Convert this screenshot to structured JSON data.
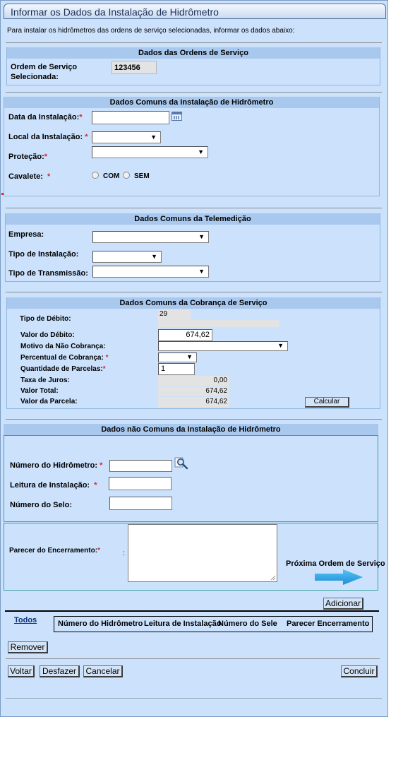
{
  "window": {
    "title": "Informar os Dados da Instalação de Hidrômetro"
  },
  "intro": "Para instalar os hidrômetros das ordens de serviço selecionadas, informar os dados abaixo:",
  "ordens": {
    "header": "Dados das Ordens de Serviço",
    "label_line1": "Ordem de Serviço",
    "label_line2": "Selecionada:",
    "value": "123456"
  },
  "instalacao": {
    "header": "Dados Comuns da Instalação de Hidrômetro",
    "data_label": "Data da Instalação:",
    "data_value": "",
    "local_label": "Local da Instalação:",
    "local_value": "",
    "protecao_label": "Proteção:",
    "protecao_value": "",
    "cavalete_label": "Cavalete:",
    "opt_com": "COM",
    "opt_sem": "SEM",
    "required_mark": "*"
  },
  "telemedicao": {
    "header": "Dados Comuns da Telemedição",
    "empresa_label": "Empresa:",
    "tipo_instalacao_label": "Tipo de Instalação:",
    "tipo_transmissao_label": "Tipo de Transmissão:"
  },
  "cobranca": {
    "header": "Dados Comuns da Cobrança de Serviço",
    "tipo_debito_label": "Tipo de Débito:",
    "tipo_debito_value": "29",
    "valor_debito_label": "Valor do Débito:",
    "valor_debito_value": "674,62",
    "motivo_label": "Motivo da Não Cobrança:",
    "percentual_label": "Percentual de Cobrança:",
    "parcelas_label": "Quantidade de Parcelas:",
    "parcelas_value": "1",
    "juros_label": "Taxa de Juros:",
    "juros_value": "0,00",
    "valor_total_label": "Valor Total:",
    "valor_total_value": "674,62",
    "valor_parcela_label": "Valor da Parcela:",
    "valor_parcela_value": "674,62",
    "calcular_button": "Calcular"
  },
  "nao_comuns": {
    "header": "Dados não Comuns da Instalação de Hidrômetro",
    "numero_hidrometro_label": "Número do Hidrômetro:",
    "leitura_label": "Leitura de Instalação:",
    "numero_selo_label": "Número do Selo:",
    "parecer_label": "Parecer do Encerramento:",
    "colon": ":",
    "proxima_label": "Próxima Ordem de Serviço"
  },
  "table": {
    "todos_link": "Todos",
    "columns": [
      "Número do Hidrômetro",
      "Leitura de Instalação",
      "Número do Sele",
      "Parecer Encerramento"
    ]
  },
  "buttons": {
    "adicionar": "Adicionar",
    "remover": "Remover",
    "voltar": "Voltar",
    "desfazer": "Desfazer",
    "cancelar": "Cancelar",
    "concluir": "Concluir"
  },
  "colors": {
    "panel_bg": "#cbe1fc",
    "section_header": "#a9c8ee",
    "required": "#d9262f",
    "arrow": "#2a9fe0"
  }
}
